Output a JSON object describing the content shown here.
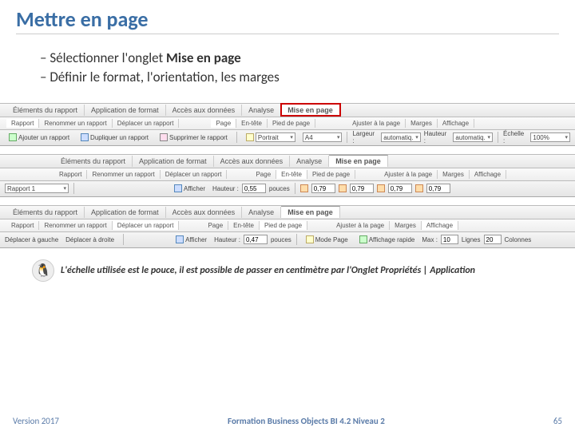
{
  "title": "Mettre en page",
  "bullets": {
    "b1_pre": "Sélectionner l'onglet ",
    "b1_bold": "Mise en page",
    "b2": "Définir le format, l'orientation, les marges"
  },
  "s1": {
    "tabs": [
      "Éléments du rapport",
      "Application de format",
      "Accès aux données",
      "Analyse",
      "Mise en page"
    ],
    "subtabs_left": [
      "Rapport",
      "Renommer un rapport",
      "Déplacer un rapport"
    ],
    "subtabs_mid": [
      "Page",
      "En-tête",
      "Pied de page"
    ],
    "subtabs_right": [
      "Ajuster à la page",
      "Marges",
      "Affichage"
    ],
    "toolbar": {
      "add": "Ajouter un rapport",
      "dup": "Dupliquer un rapport",
      "del": "Supprimer le rapport",
      "orient": "Portrait",
      "size": "A4",
      "width_lbl": "Largeur :",
      "width_val": "automatiq.",
      "height_lbl": "Hauteur :",
      "height_val": "automatiq.",
      "scale_lbl": "Échelle :",
      "scale_val": "100%"
    }
  },
  "s2": {
    "tabs": [
      "Éléments du rapport",
      "Application de format",
      "Accès aux données",
      "Analyse",
      "Mise en page"
    ],
    "subtabs_left": [
      "Rapport",
      "Renommer un rapport",
      "Déplacer un rapport"
    ],
    "subtabs_mid": [
      "Page",
      "En-tête",
      "Pied de page"
    ],
    "subtabs_right": [
      "Ajuster à la page",
      "Marges",
      "Affichage"
    ],
    "toolbar": {
      "report": "Rapport 1",
      "show": "Afficher",
      "h_lbl": "Hauteur :",
      "h_val": "0,55",
      "h_unit": "pouces",
      "m1": "0,79",
      "m2": "0,79",
      "m3": "0,79",
      "m4": "0,79"
    }
  },
  "s3": {
    "tabs": [
      "Éléments du rapport",
      "Application de format",
      "Accès aux données",
      "Analyse",
      "Mise en page"
    ],
    "subtabs_left": [
      "Rapport",
      "Renommer un rapport",
      "Déplacer un rapport"
    ],
    "subtabs_mid": [
      "Page",
      "En-tête",
      "Pied de page"
    ],
    "subtabs_right": [
      "Ajuster à la page",
      "Marges",
      "Affichage"
    ],
    "toolbar": {
      "left": "Déplacer à gauche",
      "right": "Déplacer à droite",
      "show": "Afficher",
      "h_lbl": "Hauteur :",
      "h_val": "0,47",
      "h_unit": "pouces",
      "mode": "Mode Page",
      "quick": "Affichage rapide",
      "max_lbl": "Max :",
      "max_val": "10",
      "lines_lbl": "Lignes",
      "lines_val": "20",
      "cols": "Colonnes"
    }
  },
  "note": "L'échelle utilisée est le pouce, il est possible de passer en centimètre par l'Onglet Propriétés | Application",
  "footer": {
    "version": "Version 2017",
    "center": "Formation Business Objects BI 4.2 Niveau 2",
    "page": "65"
  }
}
